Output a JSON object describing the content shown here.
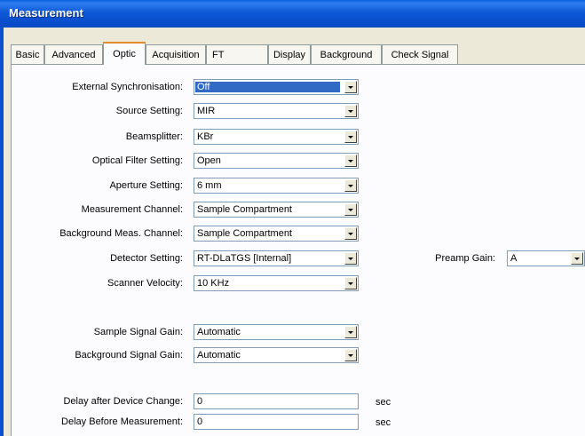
{
  "window": {
    "title": "Measurement"
  },
  "tabs": [
    {
      "label": "Basic"
    },
    {
      "label": "Advanced"
    },
    {
      "label": "Optic"
    },
    {
      "label": "Acquisition"
    },
    {
      "label": "FT"
    },
    {
      "label": "Display"
    },
    {
      "label": "Background"
    },
    {
      "label": "Check Signal"
    }
  ],
  "active_tab": "Optic",
  "fields": {
    "external_sync": {
      "label": "External Synchronisation:",
      "value": "Off"
    },
    "source": {
      "label": "Source Setting:",
      "value": "MIR"
    },
    "beamsplitter": {
      "label": "Beamsplitter:",
      "value": "KBr"
    },
    "optical_filter": {
      "label": "Optical Filter Setting:",
      "value": "Open"
    },
    "aperture": {
      "label": "Aperture Setting:",
      "value": "6 mm"
    },
    "meas_channel": {
      "label": "Measurement Channel:",
      "value": "Sample Compartment"
    },
    "bg_channel": {
      "label": "Background Meas. Channel:",
      "value": "Sample Compartment"
    },
    "detector": {
      "label": "Detector Setting:",
      "value": "RT-DLaTGS [Internal]"
    },
    "preamp_gain": {
      "label": "Preamp Gain:",
      "value": "A"
    },
    "scanner_velocity": {
      "label": "Scanner Velocity:",
      "value": "10 KHz"
    },
    "sample_gain": {
      "label": "Sample Signal Gain:",
      "value": "Automatic"
    },
    "bg_gain": {
      "label": "Background Signal Gain:",
      "value": "Automatic"
    },
    "delay_device": {
      "label": "Delay after Device Change:",
      "value": "0",
      "unit": "sec"
    },
    "delay_meas": {
      "label": "Delay Before Measurement:",
      "value": "0",
      "unit": "sec"
    }
  },
  "colors": {
    "title_bar": "#0b50cf",
    "selection": "#316ac5",
    "active_tab_accent": "#e68b2c"
  }
}
